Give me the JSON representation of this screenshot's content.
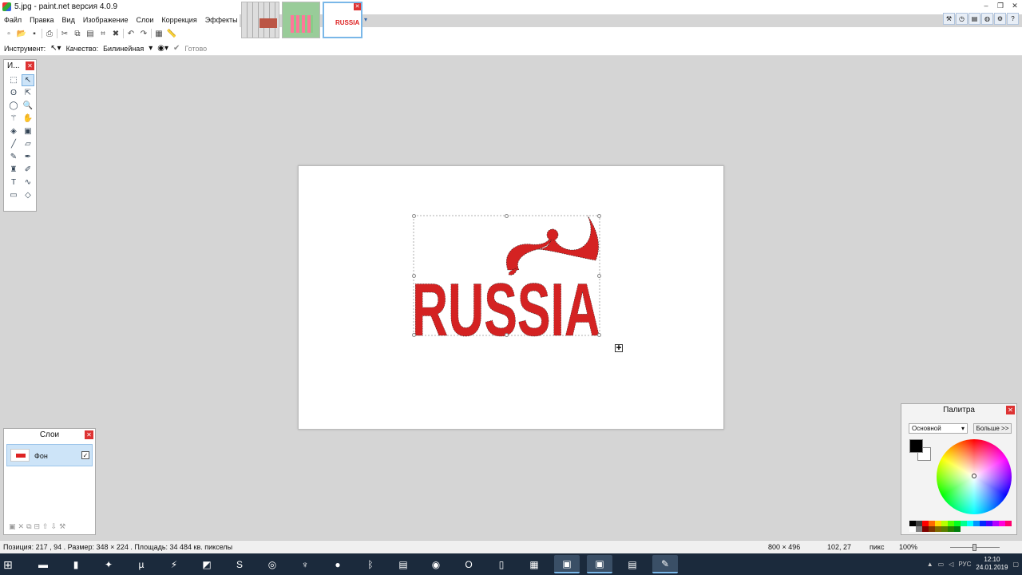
{
  "window": {
    "title": "5.jpg - paint.net версия 4.0.9"
  },
  "menu": [
    "Файл",
    "Правка",
    "Вид",
    "Изображение",
    "Слои",
    "Коррекция",
    "Эффекты"
  ],
  "thumbnails": {
    "active_label": "RUSSIA"
  },
  "tool_options": {
    "tool_label": "Инструмент:",
    "quality_label": "Качество:",
    "quality_value": "Билинейная",
    "status": "Готово"
  },
  "tools_panel": {
    "title": "И..."
  },
  "canvas": {
    "text": "RUSSIA",
    "text_color": "#d42222"
  },
  "layers_panel": {
    "title": "Слои",
    "layers": [
      {
        "name": "Фон",
        "visible": true
      }
    ]
  },
  "palette_panel": {
    "title": "Палитра",
    "mode": "Основной",
    "more_button": "Больше >>",
    "primary_color": "#000000",
    "secondary_color": "#ffffff",
    "swatches": [
      "#000000",
      "#404040",
      "#ff0000",
      "#ff6a00",
      "#ffd800",
      "#b6ff00",
      "#4cff00",
      "#00ff21",
      "#00ff90",
      "#00ffff",
      "#0094ff",
      "#0026ff",
      "#4800ff",
      "#b200ff",
      "#ff00dc",
      "#ff006e",
      "#ffffff",
      "#808080",
      "#7f0000",
      "#7f3300",
      "#7f6a00",
      "#5b7f00",
      "#267f00",
      "#007f0e"
    ]
  },
  "statusbar": {
    "selection_info": "Позиция: 217 , 94 . Размер: 348 × 224 . Площадь: 34 484 кв. пикселы",
    "image_size": "800 × 496",
    "cursor_pos": "102, 27",
    "units": "пикс",
    "zoom": "100%"
  },
  "taskbar": {
    "lang": "РУС",
    "time": "12:10",
    "date": "24.01.2019"
  }
}
